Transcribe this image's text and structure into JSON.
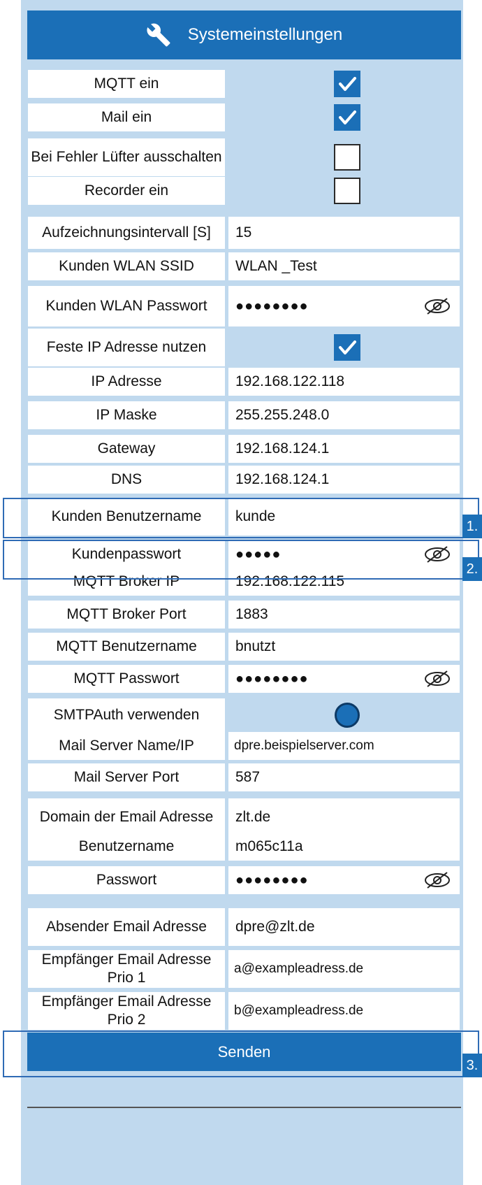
{
  "header": {
    "title": "Systemeinstellungen",
    "icon": "wrench-icon"
  },
  "fields": [
    {
      "label": "MQTT ein",
      "kind": "checkbox",
      "checked": true
    },
    {
      "label": "Mail ein",
      "kind": "checkbox",
      "checked": true
    },
    {
      "label": "Bei Fehler Lüfter ausschalten",
      "kind": "checkbox",
      "checked": false
    },
    {
      "label": "Recorder ein",
      "kind": "checkbox",
      "checked": false
    },
    {
      "label": "Aufzeichnungsintervall [S]",
      "kind": "text",
      "value": "15"
    },
    {
      "label": "Kunden WLAN SSID",
      "kind": "text",
      "value": "WLAN _Test"
    },
    {
      "label": "Kunden WLAN Passwort",
      "kind": "password",
      "value": "●●●●●●●●"
    },
    {
      "label": "Feste IP Adresse nutzen",
      "kind": "checkbox",
      "checked": true
    },
    {
      "label": "IP Adresse",
      "kind": "text",
      "value": "192.168.122.118"
    },
    {
      "label": "IP Maske",
      "kind": "text",
      "value": "255.255.248.0"
    },
    {
      "label": "Gateway",
      "kind": "text",
      "value": "192.168.124.1"
    },
    {
      "label": "DNS",
      "kind": "text",
      "value": "192.168.124.1"
    },
    {
      "label": "Kunden Benutzername",
      "kind": "text",
      "value": "kunde"
    },
    {
      "label": "Kundenpasswort",
      "kind": "password",
      "value": "●●●●●"
    },
    {
      "label": "MQTT Broker IP",
      "kind": "text",
      "value": "192.168.122.115"
    },
    {
      "label": "MQTT Broker Port",
      "kind": "text",
      "value": "1883"
    },
    {
      "label": "MQTT Benutzername",
      "kind": "text",
      "value": "bnutzt"
    },
    {
      "label": "MQTT Passwort",
      "kind": "password",
      "value": "●●●●●●●●"
    },
    {
      "label": "SMTPAuth verwenden",
      "kind": "radio",
      "checked": true
    },
    {
      "label": "Mail Server Name/IP",
      "kind": "text",
      "value": "dpre.beispielserver.com"
    },
    {
      "label": "Mail Server Port",
      "kind": "text",
      "value": "587"
    },
    {
      "label": "Domain der Email Adresse",
      "kind": "text",
      "value": "zlt.de"
    },
    {
      "label": "Benutzername",
      "kind": "text",
      "value": "m065c11a"
    },
    {
      "label": "Passwort",
      "kind": "password",
      "value": "●●●●●●●●"
    },
    {
      "label": "Absender Email Adresse",
      "kind": "text",
      "value": "dpre@zlt.de"
    },
    {
      "label": "Empfänger Email Adresse Prio 1",
      "kind": "text",
      "value": "a@exampleadress.de"
    },
    {
      "label": "Empfänger Email Adresse Prio 2",
      "kind": "text",
      "value": "b@exampleadress.de"
    }
  ],
  "callouts": [
    "1.",
    "2.",
    "3."
  ],
  "submit_label": "Senden",
  "colors": {
    "accent": "#1b6fb7",
    "panel": "#c0d9ee"
  }
}
